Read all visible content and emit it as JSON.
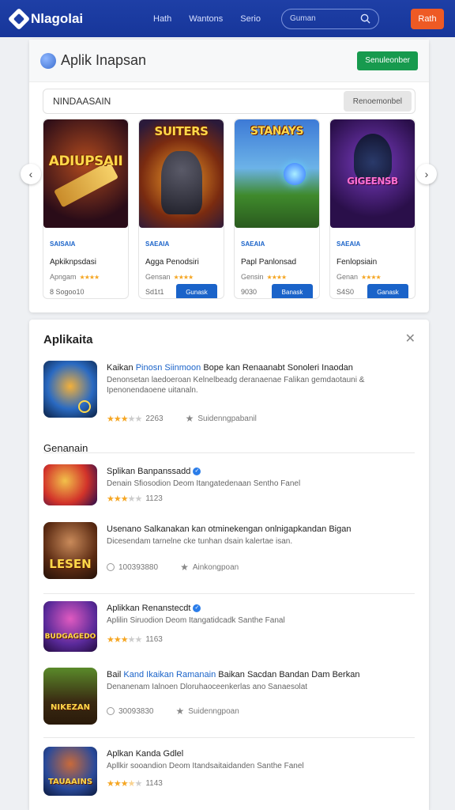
{
  "nav": {
    "logo": "Nlagolai",
    "links": [
      "Hath",
      "Wantons",
      "Serio"
    ],
    "search_placeholder": "Guman",
    "button": "Rath"
  },
  "featured": {
    "title": "Aplik Inapsan",
    "button": "Senuleonber",
    "search_label": "NINDAASAIN",
    "search_button": "Renoemonbel",
    "games": [
      {
        "art": "ADIUPSAII",
        "tag": "SAISAIA",
        "name": "Apkiknpsdasi",
        "sub": "Apngam",
        "stars": "★★★★",
        "foot": "8 Sogoo10",
        "download": ""
      },
      {
        "art": "SUITERS",
        "tag": "SAEAIA",
        "name": "Agga Penodsiri",
        "sub": "Gensan",
        "stars": "★★★★",
        "foot": "Sd1t1",
        "download": "Gunask"
      },
      {
        "art": "STANAYS",
        "tag": "SAEAIA",
        "name": "Papl Panlonsad",
        "sub": "Gensin",
        "stars": "★★★★",
        "foot": "9030",
        "download": "Banask"
      },
      {
        "art": "GIGEENSB",
        "tag": "SAEAIA",
        "name": "Fenlopsiain",
        "sub": "Genan",
        "stars": "★★★★",
        "foot": "S4S0",
        "download": "Ganask"
      }
    ]
  },
  "list": {
    "title": "Aplikaita",
    "section": "Genanain",
    "items": [
      {
        "title_a": "Kaikan",
        "title_hl": "Pinosn Siinmoon",
        "title_b": "Bope kan Renaanabt Sonoleri Inaodan",
        "desc": "Denonsetan laedoeroan Kelnelbeadg deranaenae Falikan gemdaotauni & Ipenonendaoene uitanaln.",
        "rating": "2263",
        "extra": "Suidenngpabanil",
        "full": 3,
        "verified": false,
        "icon_text": ""
      },
      {
        "title_a": "Splikan Banpanssadd",
        "title_hl": "",
        "title_b": "",
        "desc": "Denain Sfiosodion Deom Itangatedenaan Sentho Fanel",
        "rating": "1123",
        "extra": "",
        "full": 3,
        "verified": true,
        "icon_text": ""
      },
      {
        "title_a": "Usenano Salkanakan kan otminekengan onlnigapkandan Bigan",
        "title_hl": "",
        "title_b": "",
        "desc": "Dicesendam tarnelne cke tunhan dsain kalertae isan.",
        "rating": "100393880",
        "extra": "Ainkongpoan",
        "full": 0,
        "verified": false,
        "icon_text": "LESEN"
      },
      {
        "title_a": "Aplikkan Renanstecdt",
        "title_hl": "",
        "title_b": "",
        "desc": "Aplilin Siruodion Deom Itangatidcadk Santhe Fanal",
        "rating": "1163",
        "extra": "",
        "full": 3,
        "verified": true,
        "icon_text": "BUDGAGEDO"
      },
      {
        "title_a": "Bail",
        "title_hl": "Kand Ikaikan Ramanain",
        "title_b": "Baikan Sacdan Bandan Dam Berkan",
        "desc": "Denanenam Ialnoen Dloruhaoceenkerlas ano Sanaesolat",
        "rating": "30093830",
        "extra": "Suidenngpoan",
        "full": 0,
        "verified": false,
        "icon_text": "NIKEZAN"
      },
      {
        "title_a": "Aplkan Kanda Gdlel",
        "title_hl": "",
        "title_b": "",
        "desc": "Apllkir sooandion Deom Itandsaitaidanden Santhe Fanel",
        "rating": "1143",
        "extra": "",
        "full": 3.5,
        "verified": false,
        "icon_text": "TAUAAINS"
      }
    ]
  },
  "colors": {
    "nav": "#1e3fa6",
    "accent": "#1a63c9",
    "green": "#179a4e",
    "orange": "#ee5a24",
    "star": "#f5a623"
  }
}
